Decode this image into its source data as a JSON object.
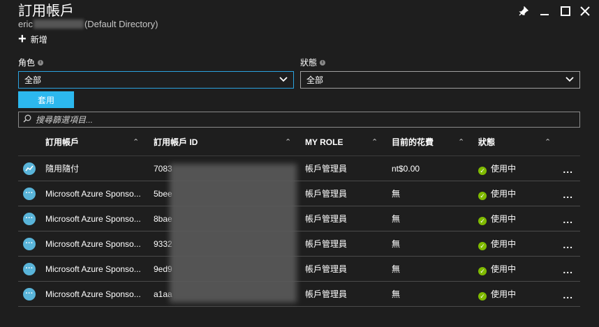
{
  "window": {
    "title": "訂用帳戶",
    "subtitle_prefix": "eric",
    "subtitle_suffix": "(Default Directory)",
    "controls": [
      "pin-icon",
      "minimize-icon",
      "maximize-icon",
      "close-icon"
    ]
  },
  "toolbar": {
    "add_label": "新增"
  },
  "filters": {
    "role_label": "角色",
    "role_value": "全部",
    "status_label": "狀態",
    "status_value": "全部",
    "apply_label": "套用",
    "search_placeholder": "搜尋篩選項目..."
  },
  "table": {
    "headers": {
      "name": "訂用帳戶",
      "id": "訂用帳戶 ID",
      "role": "MY ROLE",
      "cost": "目前的花費",
      "status": "狀態"
    },
    "rows": [
      {
        "icon": "trend-icon",
        "name": "隨用隨付",
        "id": "7083",
        "role": "帳戶管理員",
        "cost": "nt$0.00",
        "status": "使用中"
      },
      {
        "icon": "ellipsis-icon",
        "name": "Microsoft Azure Sponso...",
        "id": "5bee",
        "role": "帳戶管理員",
        "cost": "無",
        "status": "使用中"
      },
      {
        "icon": "ellipsis-icon",
        "name": "Microsoft Azure Sponso...",
        "id": "8bae",
        "role": "帳戶管理員",
        "cost": "無",
        "status": "使用中"
      },
      {
        "icon": "ellipsis-icon",
        "name": "Microsoft Azure Sponso...",
        "id": "9332",
        "role": "帳戶管理員",
        "cost": "無",
        "status": "使用中"
      },
      {
        "icon": "ellipsis-icon",
        "name": "Microsoft Azure Sponso...",
        "id": "9ed9",
        "role": "帳戶管理員",
        "cost": "無",
        "status": "使用中"
      },
      {
        "icon": "ellipsis-icon",
        "name": "Microsoft Azure Sponso...",
        "id": "a1aa",
        "role": "帳戶管理員",
        "cost": "無",
        "status": "使用中"
      }
    ],
    "more_label": "...",
    "status_color": "#7fba00"
  },
  "colors": {
    "accent": "#2cb8ee",
    "background": "#1e1e1e",
    "focus": "#2ba3e0"
  }
}
